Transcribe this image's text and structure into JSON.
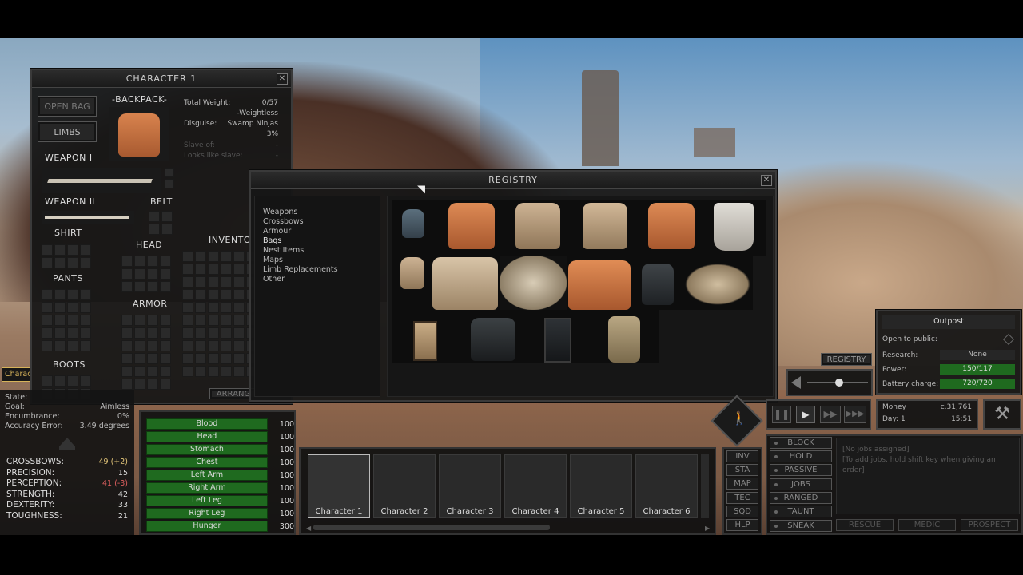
{
  "character_window": {
    "title": "CHARACTER 1",
    "buttons": {
      "open_bag": "OPEN BAG",
      "limbs": "LIMBS"
    },
    "backpack_label": "-BACKPACK-",
    "weapon1_label": "WEAPON I",
    "weapon2_label": "WEAPON II",
    "belt_label": "BELT",
    "shirt_label": "SHIRT",
    "head_label": "HEAD",
    "pants_label": "PANTS",
    "armor_label": "ARMOR",
    "boots_label": "BOOTS",
    "inventory_label": "INVENTO",
    "arrange_label": "ARRANG",
    "info": {
      "total_weight_label": "Total Weight:",
      "total_weight": "0/57",
      "weightless": "-Weightless",
      "disguise_label": "Disguise:",
      "disguise": "Swamp Ninjas",
      "disguise_pct": "3%",
      "slave_of_label": "Slave of:",
      "slave_of": "-",
      "looks_like_slave_label": "Looks like slave:",
      "looks_like_slave": "-"
    }
  },
  "registry": {
    "title": "REGISTRY",
    "categories": [
      "Weapons",
      "Crossbows",
      "Armour",
      "Bags",
      "Nest Items",
      "Maps",
      "Limb Replacements",
      "Other"
    ],
    "active_category": "Bags"
  },
  "character_status": {
    "tab": "Charac",
    "state_label": "State:",
    "goal_label": "Goal:",
    "goal": "Aimless",
    "encumbrance_label": "Encumbrance:",
    "encumbrance": "0%",
    "accuracy_label": "Accuracy Error:",
    "accuracy": "3.49 degrees"
  },
  "stats": [
    {
      "name": "CROSSBOWS:",
      "value": "49 (+2)",
      "tone": "hi"
    },
    {
      "name": "PRECISION:",
      "value": "15",
      "tone": ""
    },
    {
      "name": "PERCEPTION:",
      "value": "41 (-3)",
      "tone": "lo"
    },
    {
      "name": "STRENGTH:",
      "value": "42",
      "tone": ""
    },
    {
      "name": "DEXTERITY:",
      "value": "33",
      "tone": ""
    },
    {
      "name": "TOUGHNESS:",
      "value": "21",
      "tone": ""
    }
  ],
  "health": [
    {
      "part": "Blood",
      "value": "100"
    },
    {
      "part": "Head",
      "value": "100"
    },
    {
      "part": "Stomach",
      "value": "100"
    },
    {
      "part": "Chest",
      "value": "100"
    },
    {
      "part": "Left Arm",
      "value": "100"
    },
    {
      "part": "Right Arm",
      "value": "100"
    },
    {
      "part": "Left Leg",
      "value": "100"
    },
    {
      "part": "Right Leg",
      "value": "100"
    },
    {
      "part": "Hunger",
      "value": "300"
    }
  ],
  "squad": [
    "Character 1",
    "Character 2",
    "Character 3",
    "Character 4",
    "Character 5",
    "Character 6"
  ],
  "nav": [
    "INV",
    "STA",
    "MAP",
    "TEC",
    "SQD",
    "HLP"
  ],
  "orders": [
    "BLOCK",
    "HOLD",
    "PASSIVE",
    "JOBS",
    "RANGED",
    "TAUNT",
    "SNEAK"
  ],
  "jobs": {
    "line1": "[No jobs assigned]",
    "line2": "[To add jobs, hold shift key when giving an order]"
  },
  "squad_actions": [
    "RESCUE",
    "MEDIC",
    "PROSPECT"
  ],
  "outpost": {
    "title": "Outpost",
    "open_label": "Open to public:",
    "research_label": "Research:",
    "research": "None",
    "power_label": "Power:",
    "power": "150/117",
    "battery_label": "Battery charge:",
    "battery": "720/720"
  },
  "registry_button": "REGISTRY",
  "money": {
    "label": "Money",
    "value": "c.31,761",
    "day_label": "Day: 1",
    "time": "15:51"
  },
  "volume_level": 0.52,
  "colors": {
    "health_green": "#1f6a1f",
    "stat_hi": "#e5c77a",
    "stat_lo": "#e06060"
  }
}
